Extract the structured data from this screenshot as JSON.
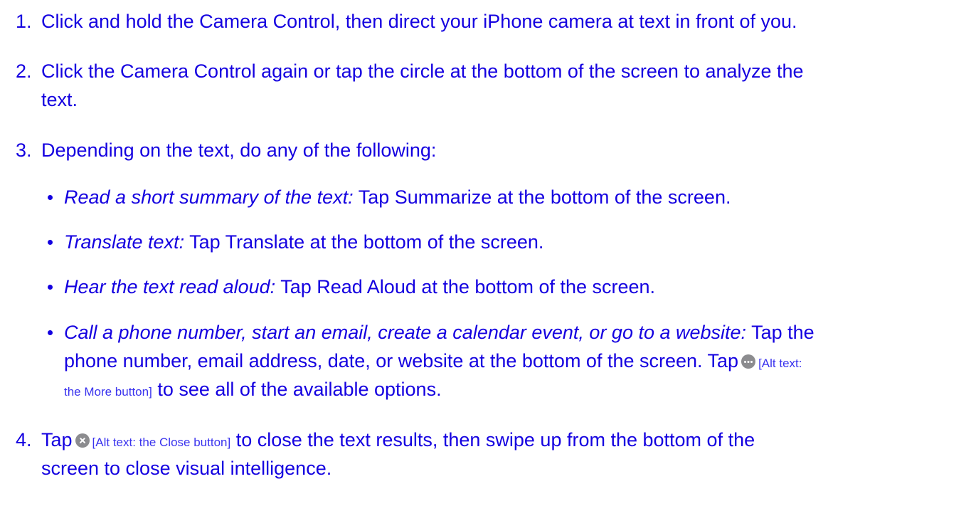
{
  "steps": [
    {
      "number": "1.",
      "text": "Click and hold the Camera Control, then direct your iPhone camera at text in front of you."
    },
    {
      "number": "2.",
      "line1": "Click the Camera Control again or tap the circle at the bottom of the screen to analyze the",
      "line2": "text."
    },
    {
      "number": "3.",
      "text": "Depending on the text, do any of the following:",
      "bullets": [
        {
          "label": "Read a short summary of the text:",
          "text": " Tap Summarize at the bottom of the screen."
        },
        {
          "label": "Translate text:",
          "text": " Tap Translate at the bottom of the screen."
        },
        {
          "label": "Hear the text read aloud:",
          "text": " Tap Read Aloud at the bottom of the screen."
        },
        {
          "label": "Call a phone number, start an email, create a calendar event, or go to a website:",
          "text_end_line1": " Tap the",
          "line2_pre": "phone number, email address, date, or website at the bottom of the screen. Tap",
          "alt_a": "[Alt text:",
          "alt_b": "the More button]",
          "line3_post": " to see all of the available options.",
          "icon": "more-icon"
        }
      ]
    },
    {
      "number": "4.",
      "pre": "Tap",
      "alt": "[Alt text: the Close button]",
      "post": " to close the text results, then swipe up from the bottom of the",
      "line2": "screen to close visual intelligence.",
      "icon": "close-icon"
    }
  ],
  "colors": {
    "text": "#1400e0",
    "icon": "#8c8c8f",
    "background": "#ffffff"
  }
}
